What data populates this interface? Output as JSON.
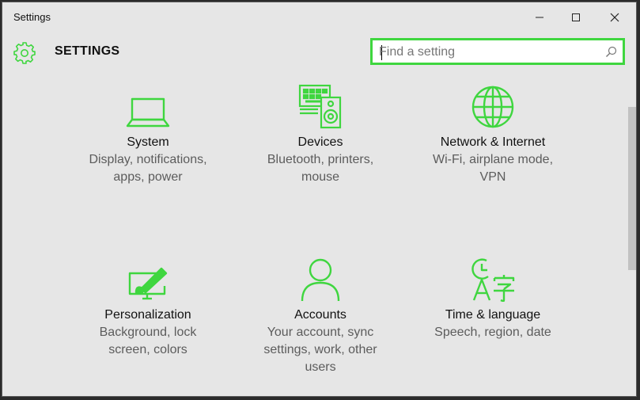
{
  "window": {
    "title": "Settings"
  },
  "header": {
    "app_title": "SETTINGS"
  },
  "search": {
    "placeholder": "Find a setting"
  },
  "colors": {
    "accent": "#3fd63f",
    "background": "#e6e6e6"
  },
  "tiles": [
    {
      "name": "System",
      "desc": "Display, notifications, apps, power",
      "icon": "laptop-icon"
    },
    {
      "name": "Devices",
      "desc": "Bluetooth, printers, mouse",
      "icon": "devices-icon"
    },
    {
      "name": "Network & Internet",
      "desc": "Wi-Fi, airplane mode, VPN",
      "icon": "globe-icon"
    },
    {
      "name": "Personalization",
      "desc": "Background, lock screen, colors",
      "icon": "paintbrush-icon"
    },
    {
      "name": "Accounts",
      "desc": "Your account, sync settings, work, other users",
      "icon": "person-icon"
    },
    {
      "name": "Time & language",
      "desc": "Speech, region, date",
      "icon": "time-language-icon"
    }
  ]
}
